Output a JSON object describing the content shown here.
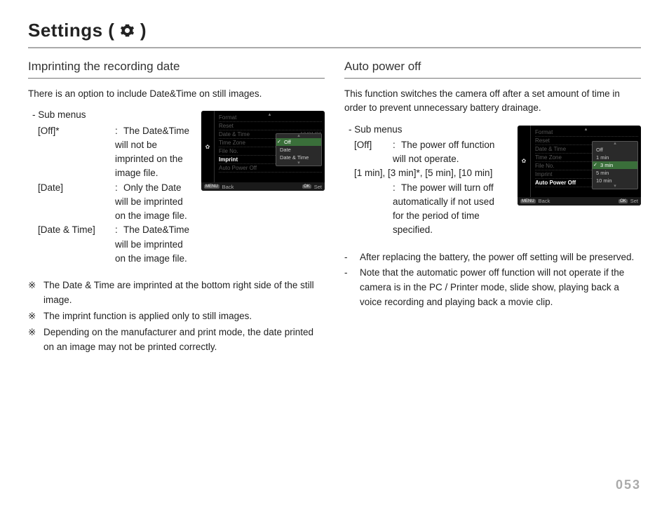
{
  "page_number": "053",
  "title_prefix": "Settings ( ",
  "title_suffix": " )",
  "left": {
    "heading": "Imprinting the recording date",
    "intro": "There is an option to include Date&Time on still images.",
    "sub_label": "- Sub menus",
    "rows": [
      {
        "label": "[Off]*",
        "value": "The Date&Time will not be imprinted on the image file."
      },
      {
        "label": "[Date]",
        "value": "Only the Date will be imprinted on the image file."
      },
      {
        "label": "[Date & Time]",
        "value": "The Date&Time will be imprinted on the image file."
      }
    ],
    "notes_mark": "※",
    "notes": [
      "The Date & Time are imprinted at the bottom right side of the still image.",
      "The imprint function is applied only to still images.",
      "Depending on the manufacturer and print mode, the date printed on an image may not be printed correctly."
    ],
    "camera": {
      "menu_items": [
        {
          "label": "Format",
          "dim": true
        },
        {
          "label": "Reset",
          "dim": true
        },
        {
          "label": "Date & Time",
          "right": "10/01/01",
          "dim": true
        },
        {
          "label": "Time Zone",
          "dim": true
        },
        {
          "label": "File No.",
          "dim": true
        },
        {
          "label": "Imprint",
          "hi": true
        },
        {
          "label": "Auto Power Off",
          "dim": true
        }
      ],
      "popup": [
        "Off",
        "Date",
        "Date & Time"
      ],
      "popup_selected_index": 0,
      "footer_back": "Back",
      "footer_set": "Set",
      "key_menu": "MENU",
      "key_ok": "OK"
    }
  },
  "right": {
    "heading": "Auto power off",
    "intro": "This function switches the camera off after a set amount of time in order to prevent unnecessary battery drainage.",
    "sub_label": "- Sub menus",
    "rows": [
      {
        "label": "[Off]",
        "value": "The power off function will not operate."
      },
      {
        "label": "[1 min], [3 min]*, [5 min], [10 min]",
        "value": "The power will turn off automatically if not used for the period of time specified."
      }
    ],
    "notes_dash": "- ",
    "notes": [
      "After replacing the battery, the power off setting will be preserved.",
      "Note that the automatic power off function will not operate if the camera is in the PC / Printer mode, slide show, playing back a voice recording and playing back a movie clip."
    ],
    "camera": {
      "menu_items": [
        {
          "label": "Format",
          "dim": true
        },
        {
          "label": "Reset",
          "dim": true
        },
        {
          "label": "Date & Time",
          "dim": true
        },
        {
          "label": "Time Zone",
          "dim": true
        },
        {
          "label": "File No.",
          "dim": true
        },
        {
          "label": "Imprint",
          "dim": true
        },
        {
          "label": "Auto Power Off",
          "hi": true
        }
      ],
      "popup": [
        "Off",
        "1 min",
        "3 min",
        "5 min",
        "10 min"
      ],
      "popup_selected_index": 2,
      "footer_back": "Back",
      "footer_set": "Set",
      "key_menu": "MENU",
      "key_ok": "OK"
    }
  }
}
